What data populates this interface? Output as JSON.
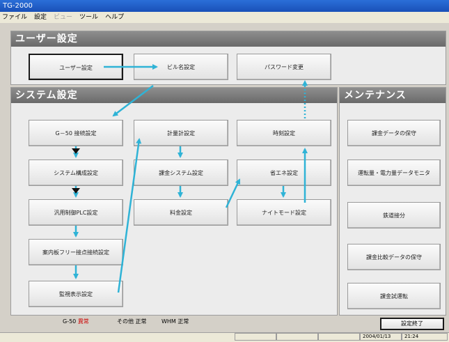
{
  "window": {
    "title": "TG-2000"
  },
  "menu": [
    {
      "label": "ファイル",
      "enabled": true
    },
    {
      "label": "設定",
      "enabled": true
    },
    {
      "label": "ビュー",
      "enabled": false
    },
    {
      "label": "ツール",
      "enabled": true
    },
    {
      "label": "ヘルプ",
      "enabled": true
    }
  ],
  "user_section": {
    "title": "ユーザー設定",
    "buttons": {
      "user": "ユーザー設定",
      "building": "ビル名設定",
      "password": "パスワード変更"
    }
  },
  "system_section": {
    "title": "システム設定",
    "buttons": {
      "g50": "G－50 接続設定",
      "system_config": "システム構成設定",
      "plc": "汎用制御PLC設定",
      "guide": "案内板フリー接点接続設定",
      "monitor": "監視表示設定",
      "meter": "計量計設定",
      "billing_system": "課金システム設定",
      "fee": "料金設定",
      "clock": "時刻設定",
      "energy": "省エネ設定",
      "night": "ナイトモード設定"
    }
  },
  "maintenance_section": {
    "title": "メンテナンス",
    "buttons": {
      "billing_data": "課金データの保守",
      "power_monitor": "運転量・電力量データモニタ",
      "pulse": "鉄道接分",
      "compare": "課金比較データの保守",
      "trial": "課金試運転"
    }
  },
  "status": {
    "g50_label": "G-50",
    "g50_value": "異常",
    "other_label": "その他",
    "other_value": "正常",
    "whm_label": "WHM",
    "whm_value": "正常"
  },
  "end_button": "設定終了",
  "statusbar": {
    "date": "2004/01/13",
    "time": "21:24"
  },
  "colors": {
    "arrow": "#2fb3d6",
    "error": "#cc0000",
    "header": "#7a7a7a"
  }
}
